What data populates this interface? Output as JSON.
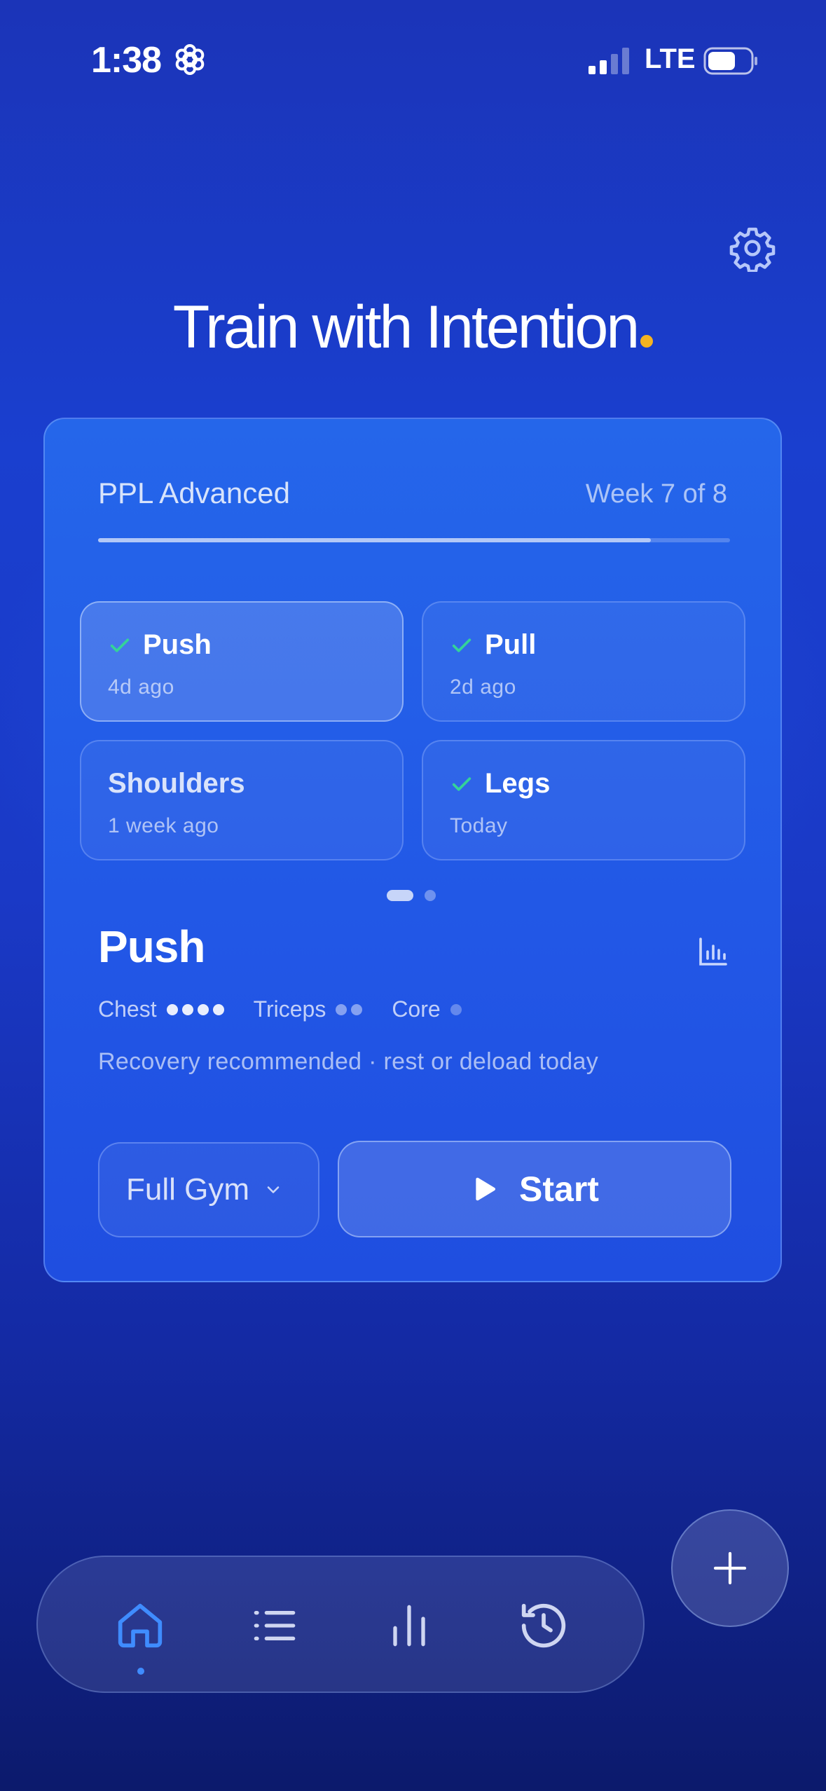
{
  "status_bar": {
    "time": "1:38",
    "network": "LTE",
    "signal_bars_active": 2,
    "signal_bars_total": 4,
    "battery_level": 0.65
  },
  "hero": {
    "title": "Train with Intention",
    "accent_color": "#f5b321"
  },
  "program": {
    "name": "PPL Advanced",
    "week_label": "Week 7 of 8",
    "progress": 0.875
  },
  "days": [
    {
      "title": "Push",
      "subtitle": "4d ago",
      "completed": true,
      "selected": true
    },
    {
      "title": "Pull",
      "subtitle": "2d ago",
      "completed": true,
      "selected": false
    },
    {
      "title": "Shoulders",
      "subtitle": "1 week ago",
      "completed": false,
      "selected": false
    },
    {
      "title": "Legs",
      "subtitle": "Today",
      "completed": true,
      "selected": false
    }
  ],
  "pager": {
    "pages": 2,
    "current": 0
  },
  "workout": {
    "title": "Push",
    "muscles": [
      {
        "label": "Chest",
        "intensity": 4
      },
      {
        "label": "Triceps",
        "intensity": 2
      },
      {
        "label": "Core",
        "intensity": 1
      }
    ],
    "recovery_note": "Recovery recommended · rest or deload today"
  },
  "actions": {
    "equipment_label": "Full Gym",
    "start_label": "Start"
  },
  "nav": {
    "tabs": [
      {
        "icon": "home-icon",
        "active": true
      },
      {
        "icon": "list-icon",
        "active": false
      },
      {
        "icon": "bar-chart-icon",
        "active": false
      },
      {
        "icon": "history-icon",
        "active": false
      }
    ],
    "active_color": "#3f8cff",
    "fab_icon": "plus-icon"
  },
  "colors": {
    "check": "#34d399",
    "card": "#2566ea"
  }
}
